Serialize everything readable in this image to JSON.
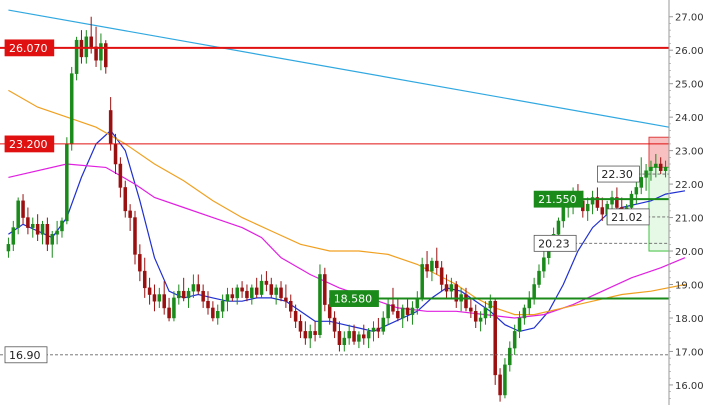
{
  "chart_data": {
    "type": "candlestick",
    "y_axis": {
      "side": "right",
      "range": [
        15.4,
        27.5
      ],
      "ticks": [
        "27.00",
        "26.00",
        "25.00",
        "24.00",
        "23.00",
        "22.00",
        "21.00",
        "20.00",
        "19.00",
        "18.00",
        "17.00",
        "16.00"
      ]
    },
    "grid": false,
    "candles": [
      [
        20.0,
        20.4,
        19.8,
        20.2
      ],
      [
        20.2,
        20.9,
        20.0,
        20.7
      ],
      [
        20.7,
        21.6,
        20.5,
        21.5
      ],
      [
        21.5,
        21.7,
        20.8,
        21.0
      ],
      [
        21.0,
        21.3,
        20.5,
        20.7
      ],
      [
        20.7,
        21.0,
        20.4,
        20.8
      ],
      [
        20.8,
        21.1,
        20.3,
        20.5
      ],
      [
        20.5,
        20.9,
        20.2,
        20.8
      ],
      [
        20.8,
        21.0,
        20.0,
        20.2
      ],
      [
        20.2,
        20.6,
        19.8,
        20.5
      ],
      [
        20.5,
        20.9,
        20.2,
        20.6
      ],
      [
        20.6,
        21.0,
        20.4,
        20.9
      ],
      [
        20.9,
        23.4,
        20.8,
        23.2
      ],
      [
        23.2,
        25.5,
        23.0,
        25.3
      ],
      [
        25.3,
        26.4,
        25.1,
        26.3
      ],
      [
        26.3,
        26.6,
        25.6,
        25.8
      ],
      [
        25.8,
        26.6,
        25.6,
        26.4
      ],
      [
        26.4,
        27.0,
        25.9,
        26.1
      ],
      [
        26.1,
        26.7,
        25.5,
        25.7
      ],
      [
        25.7,
        26.5,
        25.4,
        26.2
      ],
      [
        26.2,
        26.3,
        25.3,
        25.5
      ],
      [
        24.2,
        24.6,
        23.0,
        23.2
      ],
      [
        23.2,
        23.5,
        22.3,
        22.6
      ],
      [
        22.6,
        22.8,
        21.6,
        21.9
      ],
      [
        21.9,
        22.1,
        21.0,
        21.2
      ],
      [
        21.2,
        21.4,
        20.6,
        21.0
      ],
      [
        21.0,
        21.2,
        19.6,
        19.9
      ],
      [
        19.9,
        20.2,
        19.1,
        19.4
      ],
      [
        19.4,
        19.8,
        18.6,
        18.9
      ],
      [
        18.9,
        19.2,
        18.4,
        18.7
      ],
      [
        18.7,
        19.0,
        18.2,
        18.5
      ],
      [
        18.5,
        18.9,
        18.3,
        18.7
      ],
      [
        18.7,
        19.1,
        18.1,
        18.3
      ],
      [
        18.3,
        18.6,
        17.9,
        18.0
      ],
      [
        18.0,
        18.8,
        17.9,
        18.6
      ],
      [
        18.6,
        19.0,
        18.4,
        18.8
      ],
      [
        18.8,
        19.2,
        18.5,
        18.6
      ],
      [
        18.6,
        18.9,
        18.3,
        18.8
      ],
      [
        18.8,
        19.3,
        18.6,
        19.0
      ],
      [
        19.0,
        19.3,
        18.7,
        18.8
      ],
      [
        18.8,
        19.0,
        18.3,
        18.5
      ],
      [
        18.5,
        18.8,
        18.1,
        18.3
      ],
      [
        18.3,
        18.5,
        17.9,
        18.0
      ],
      [
        18.0,
        18.4,
        17.8,
        18.2
      ],
      [
        18.2,
        18.7,
        18.0,
        18.5
      ],
      [
        18.5,
        18.9,
        18.2,
        18.7
      ],
      [
        18.7,
        18.9,
        18.5,
        18.6
      ],
      [
        18.6,
        19.0,
        18.4,
        18.9
      ],
      [
        18.9,
        19.1,
        18.6,
        18.8
      ],
      [
        18.8,
        19.0,
        18.5,
        18.6
      ],
      [
        18.6,
        19.0,
        18.4,
        18.9
      ],
      [
        18.9,
        19.2,
        18.6,
        18.7
      ],
      [
        18.7,
        19.3,
        18.6,
        19.1
      ],
      [
        19.1,
        19.4,
        18.8,
        19.0
      ],
      [
        19.0,
        19.2,
        18.6,
        18.7
      ],
      [
        18.7,
        19.0,
        18.4,
        18.9
      ],
      [
        18.9,
        19.1,
        18.5,
        18.6
      ],
      [
        18.6,
        19.0,
        18.3,
        18.5
      ],
      [
        18.5,
        18.7,
        18.0,
        18.2
      ],
      [
        18.2,
        18.4,
        17.7,
        17.9
      ],
      [
        17.9,
        18.1,
        17.4,
        17.6
      ],
      [
        17.6,
        17.9,
        17.2,
        17.4
      ],
      [
        17.4,
        17.8,
        17.1,
        17.6
      ],
      [
        17.6,
        17.9,
        17.3,
        17.5
      ],
      [
        17.5,
        19.6,
        17.4,
        19.3
      ],
      [
        19.3,
        19.5,
        18.2,
        18.4
      ],
      [
        18.4,
        18.6,
        17.8,
        18.0
      ],
      [
        18.0,
        18.2,
        17.4,
        17.6
      ],
      [
        17.6,
        17.9,
        17.0,
        17.2
      ],
      [
        17.2,
        17.6,
        17.0,
        17.4
      ],
      [
        17.4,
        17.8,
        17.2,
        17.6
      ],
      [
        17.6,
        17.8,
        17.2,
        17.3
      ],
      [
        17.3,
        17.6,
        17.1,
        17.5
      ],
      [
        17.5,
        17.8,
        17.2,
        17.4
      ],
      [
        17.4,
        17.7,
        17.1,
        17.6
      ],
      [
        17.6,
        17.9,
        17.3,
        17.7
      ],
      [
        17.7,
        18.0,
        17.4,
        17.6
      ],
      [
        17.6,
        18.2,
        17.5,
        18.0
      ],
      [
        18.0,
        18.6,
        17.8,
        18.4
      ],
      [
        18.4,
        18.9,
        18.1,
        18.2
      ],
      [
        18.2,
        18.6,
        17.9,
        18.0
      ],
      [
        18.0,
        18.4,
        17.7,
        18.3
      ],
      [
        18.3,
        18.6,
        17.9,
        18.1
      ],
      [
        18.1,
        18.5,
        17.8,
        18.3
      ],
      [
        18.3,
        18.8,
        18.1,
        18.6
      ],
      [
        18.6,
        19.8,
        18.5,
        19.6
      ],
      [
        19.6,
        20.0,
        19.2,
        19.4
      ],
      [
        19.4,
        19.8,
        19.1,
        19.7
      ],
      [
        19.7,
        20.1,
        19.3,
        19.5
      ],
      [
        19.5,
        19.7,
        18.8,
        19.0
      ],
      [
        19.0,
        19.3,
        18.6,
        18.8
      ],
      [
        18.8,
        19.2,
        18.6,
        19.0
      ],
      [
        19.0,
        19.1,
        18.3,
        18.5
      ],
      [
        18.5,
        18.9,
        18.2,
        18.7
      ],
      [
        18.7,
        18.9,
        18.2,
        18.3
      ],
      [
        18.3,
        18.6,
        18.0,
        18.2
      ],
      [
        18.2,
        18.4,
        17.7,
        17.9
      ],
      [
        17.9,
        18.2,
        17.6,
        18.0
      ],
      [
        18.0,
        18.5,
        17.8,
        18.3
      ],
      [
        18.3,
        18.7,
        18.0,
        18.5
      ],
      [
        18.5,
        18.6,
        16.0,
        16.3
      ],
      [
        16.3,
        16.5,
        15.5,
        15.7
      ],
      [
        15.7,
        16.8,
        15.6,
        16.6
      ],
      [
        16.6,
        17.3,
        16.4,
        17.1
      ],
      [
        17.1,
        17.8,
        16.9,
        17.6
      ],
      [
        17.6,
        18.2,
        17.4,
        18.0
      ],
      [
        18.0,
        18.4,
        17.8,
        18.3
      ],
      [
        18.3,
        18.8,
        18.1,
        18.6
      ],
      [
        18.6,
        19.2,
        18.4,
        19.0
      ],
      [
        19.0,
        19.6,
        18.9,
        19.4
      ],
      [
        19.4,
        20.0,
        19.2,
        19.8
      ],
      [
        19.8,
        20.4,
        19.6,
        20.3
      ],
      [
        20.3,
        20.7,
        20.0,
        20.5
      ],
      [
        20.5,
        21.0,
        20.2,
        20.9
      ],
      [
        20.9,
        21.5,
        20.7,
        21.3
      ],
      [
        21.3,
        21.7,
        21.0,
        21.4
      ],
      [
        21.4,
        21.9,
        21.1,
        21.7
      ],
      [
        21.7,
        22.0,
        21.3,
        21.5
      ],
      [
        21.5,
        21.8,
        21.0,
        21.2
      ],
      [
        21.2,
        21.6,
        20.9,
        21.4
      ],
      [
        21.4,
        21.8,
        21.1,
        21.6
      ],
      [
        21.6,
        21.9,
        21.2,
        21.3
      ],
      [
        21.3,
        21.6,
        20.9,
        21.1
      ],
      [
        21.1,
        21.5,
        20.8,
        21.4
      ],
      [
        21.4,
        21.8,
        21.1,
        21.6
      ],
      [
        21.6,
        21.9,
        21.2,
        21.3
      ],
      [
        21.3,
        21.6,
        20.9,
        21.0
      ],
      [
        21.0,
        21.4,
        20.8,
        21.3
      ],
      [
        21.3,
        21.8,
        21.1,
        21.7
      ],
      [
        21.7,
        22.1,
        21.4,
        21.9
      ],
      [
        21.9,
        22.8,
        21.7,
        22.2
      ],
      [
        22.2,
        22.6,
        21.8,
        22.4
      ],
      [
        22.4,
        22.7,
        22.1,
        22.5
      ],
      [
        22.5,
        22.9,
        22.2,
        22.6
      ],
      [
        22.6,
        22.8,
        22.3,
        22.4
      ],
      [
        22.4,
        22.7,
        22.2,
        22.5
      ]
    ],
    "moving_averages": [
      {
        "color": "#2030d0",
        "values": [
          [
            0,
            20.5
          ],
          [
            3,
            20.8
          ],
          [
            6,
            20.6
          ],
          [
            9,
            20.4
          ],
          [
            12,
            21.0
          ],
          [
            15,
            22.2
          ],
          [
            18,
            23.2
          ],
          [
            21,
            23.6
          ],
          [
            24,
            23.0
          ],
          [
            27,
            21.5
          ],
          [
            30,
            19.8
          ],
          [
            33,
            18.8
          ],
          [
            36,
            18.6
          ],
          [
            39,
            18.7
          ],
          [
            42,
            18.6
          ],
          [
            45,
            18.5
          ],
          [
            48,
            18.5
          ],
          [
            51,
            18.6
          ],
          [
            54,
            18.6
          ],
          [
            57,
            18.5
          ],
          [
            60,
            18.2
          ],
          [
            63,
            17.9
          ],
          [
            66,
            17.9
          ],
          [
            69,
            17.8
          ],
          [
            72,
            17.7
          ],
          [
            75,
            17.6
          ],
          [
            78,
            17.8
          ],
          [
            81,
            18.0
          ],
          [
            84,
            18.2
          ],
          [
            87,
            18.6
          ],
          [
            90,
            18.9
          ],
          [
            93,
            18.8
          ],
          [
            96,
            18.5
          ],
          [
            99,
            18.2
          ],
          [
            102,
            17.8
          ],
          [
            105,
            17.6
          ],
          [
            108,
            17.7
          ],
          [
            111,
            18.2
          ],
          [
            114,
            19.0
          ],
          [
            117,
            20.0
          ],
          [
            120,
            20.7
          ],
          [
            123,
            21.1
          ],
          [
            126,
            21.3
          ],
          [
            129,
            21.4
          ],
          [
            132,
            21.5
          ],
          [
            135,
            21.7
          ],
          [
            139,
            21.8
          ]
        ]
      },
      {
        "color": "#e020e0",
        "values": [
          [
            0,
            22.2
          ],
          [
            12,
            22.6
          ],
          [
            20,
            22.5
          ],
          [
            26,
            22.0
          ],
          [
            30,
            21.6
          ],
          [
            36,
            21.3
          ],
          [
            42,
            21.0
          ],
          [
            48,
            20.7
          ],
          [
            52,
            20.4
          ],
          [
            56,
            19.8
          ],
          [
            62,
            19.3
          ],
          [
            68,
            18.9
          ],
          [
            74,
            18.6
          ],
          [
            80,
            18.3
          ],
          [
            86,
            18.2
          ],
          [
            92,
            18.2
          ],
          [
            98,
            18.1
          ],
          [
            104,
            18.0
          ],
          [
            110,
            18.1
          ],
          [
            116,
            18.4
          ],
          [
            122,
            18.8
          ],
          [
            128,
            19.2
          ],
          [
            134,
            19.5
          ],
          [
            139,
            19.8
          ]
        ]
      },
      {
        "color": "#f0a020",
        "values": [
          [
            0,
            24.8
          ],
          [
            6,
            24.3
          ],
          [
            12,
            24.0
          ],
          [
            18,
            23.7
          ],
          [
            24,
            23.2
          ],
          [
            30,
            22.6
          ],
          [
            36,
            22.1
          ],
          [
            42,
            21.5
          ],
          [
            48,
            21.0
          ],
          [
            54,
            20.6
          ],
          [
            60,
            20.2
          ],
          [
            66,
            20.0
          ],
          [
            72,
            20.0
          ],
          [
            78,
            19.9
          ],
          [
            84,
            19.6
          ],
          [
            88,
            19.3
          ],
          [
            92,
            19.0
          ],
          [
            96,
            18.6
          ],
          [
            100,
            18.3
          ],
          [
            104,
            18.1
          ],
          [
            108,
            18.1
          ],
          [
            114,
            18.3
          ],
          [
            120,
            18.5
          ],
          [
            126,
            18.7
          ],
          [
            132,
            18.8
          ],
          [
            139,
            19.0
          ]
        ]
      }
    ],
    "trendline": {
      "color": "#30a8e0",
      "from": [
        0,
        27.2
      ],
      "to": [
        139,
        23.7
      ]
    },
    "levels": [
      {
        "label": "26.070",
        "value": 26.07,
        "style": "solid",
        "color": "#e01010",
        "label_side": "left",
        "label_fill": "#e01010",
        "label_text": "#ffffff"
      },
      {
        "label": "23.200",
        "value": 23.2,
        "style": "solid-thin",
        "color": "#e01010",
        "label_side": "left",
        "label_fill": "#e01010",
        "label_text": "#ffffff"
      },
      {
        "label": "22.30",
        "value": 22.3,
        "style": "dashed",
        "color": "#666666",
        "label_side": "mid",
        "label_fill": "#ffffff",
        "label_text": "#222222",
        "from_index": 121
      },
      {
        "label": "21.550",
        "value": 21.55,
        "style": "solid",
        "color": "#1a8a1a",
        "label_side": "mid",
        "label_fill": "#1a8a1a",
        "label_text": "#ffffff",
        "from_index": 108
      },
      {
        "label": "21.02",
        "value": 21.02,
        "style": "dashed",
        "color": "#666666",
        "label_side": "mid",
        "label_fill": "#ffffff",
        "label_text": "#222222",
        "from_index": 123
      },
      {
        "label": "20.23",
        "value": 20.23,
        "style": "dashed",
        "color": "#666666",
        "label_side": "mid",
        "label_fill": "#ffffff",
        "label_text": "#222222",
        "from_index": 108
      },
      {
        "label": "18.580",
        "value": 18.58,
        "style": "solid",
        "color": "#1a8a1a",
        "label_side": "mid",
        "label_fill": "#1a8a1a",
        "label_text": "#ffffff",
        "from_index": 66
      },
      {
        "label": "16.90",
        "value": 16.9,
        "style": "dashed",
        "color": "#666666",
        "label_side": "left",
        "label_fill": "#ffffff",
        "label_text": "#222222"
      }
    ],
    "zones": [
      {
        "from": 22.5,
        "to": 23.4,
        "fill": "#f8c0c0",
        "stroke": "#e04040"
      },
      {
        "from": 20.0,
        "to": 22.5,
        "fill": "#e6f8e6",
        "stroke": "#40c040"
      }
    ],
    "colors": {
      "up": "#1a8a1a",
      "down": "#9a1010",
      "background": "#ffffff",
      "axis": "#999999"
    }
  }
}
